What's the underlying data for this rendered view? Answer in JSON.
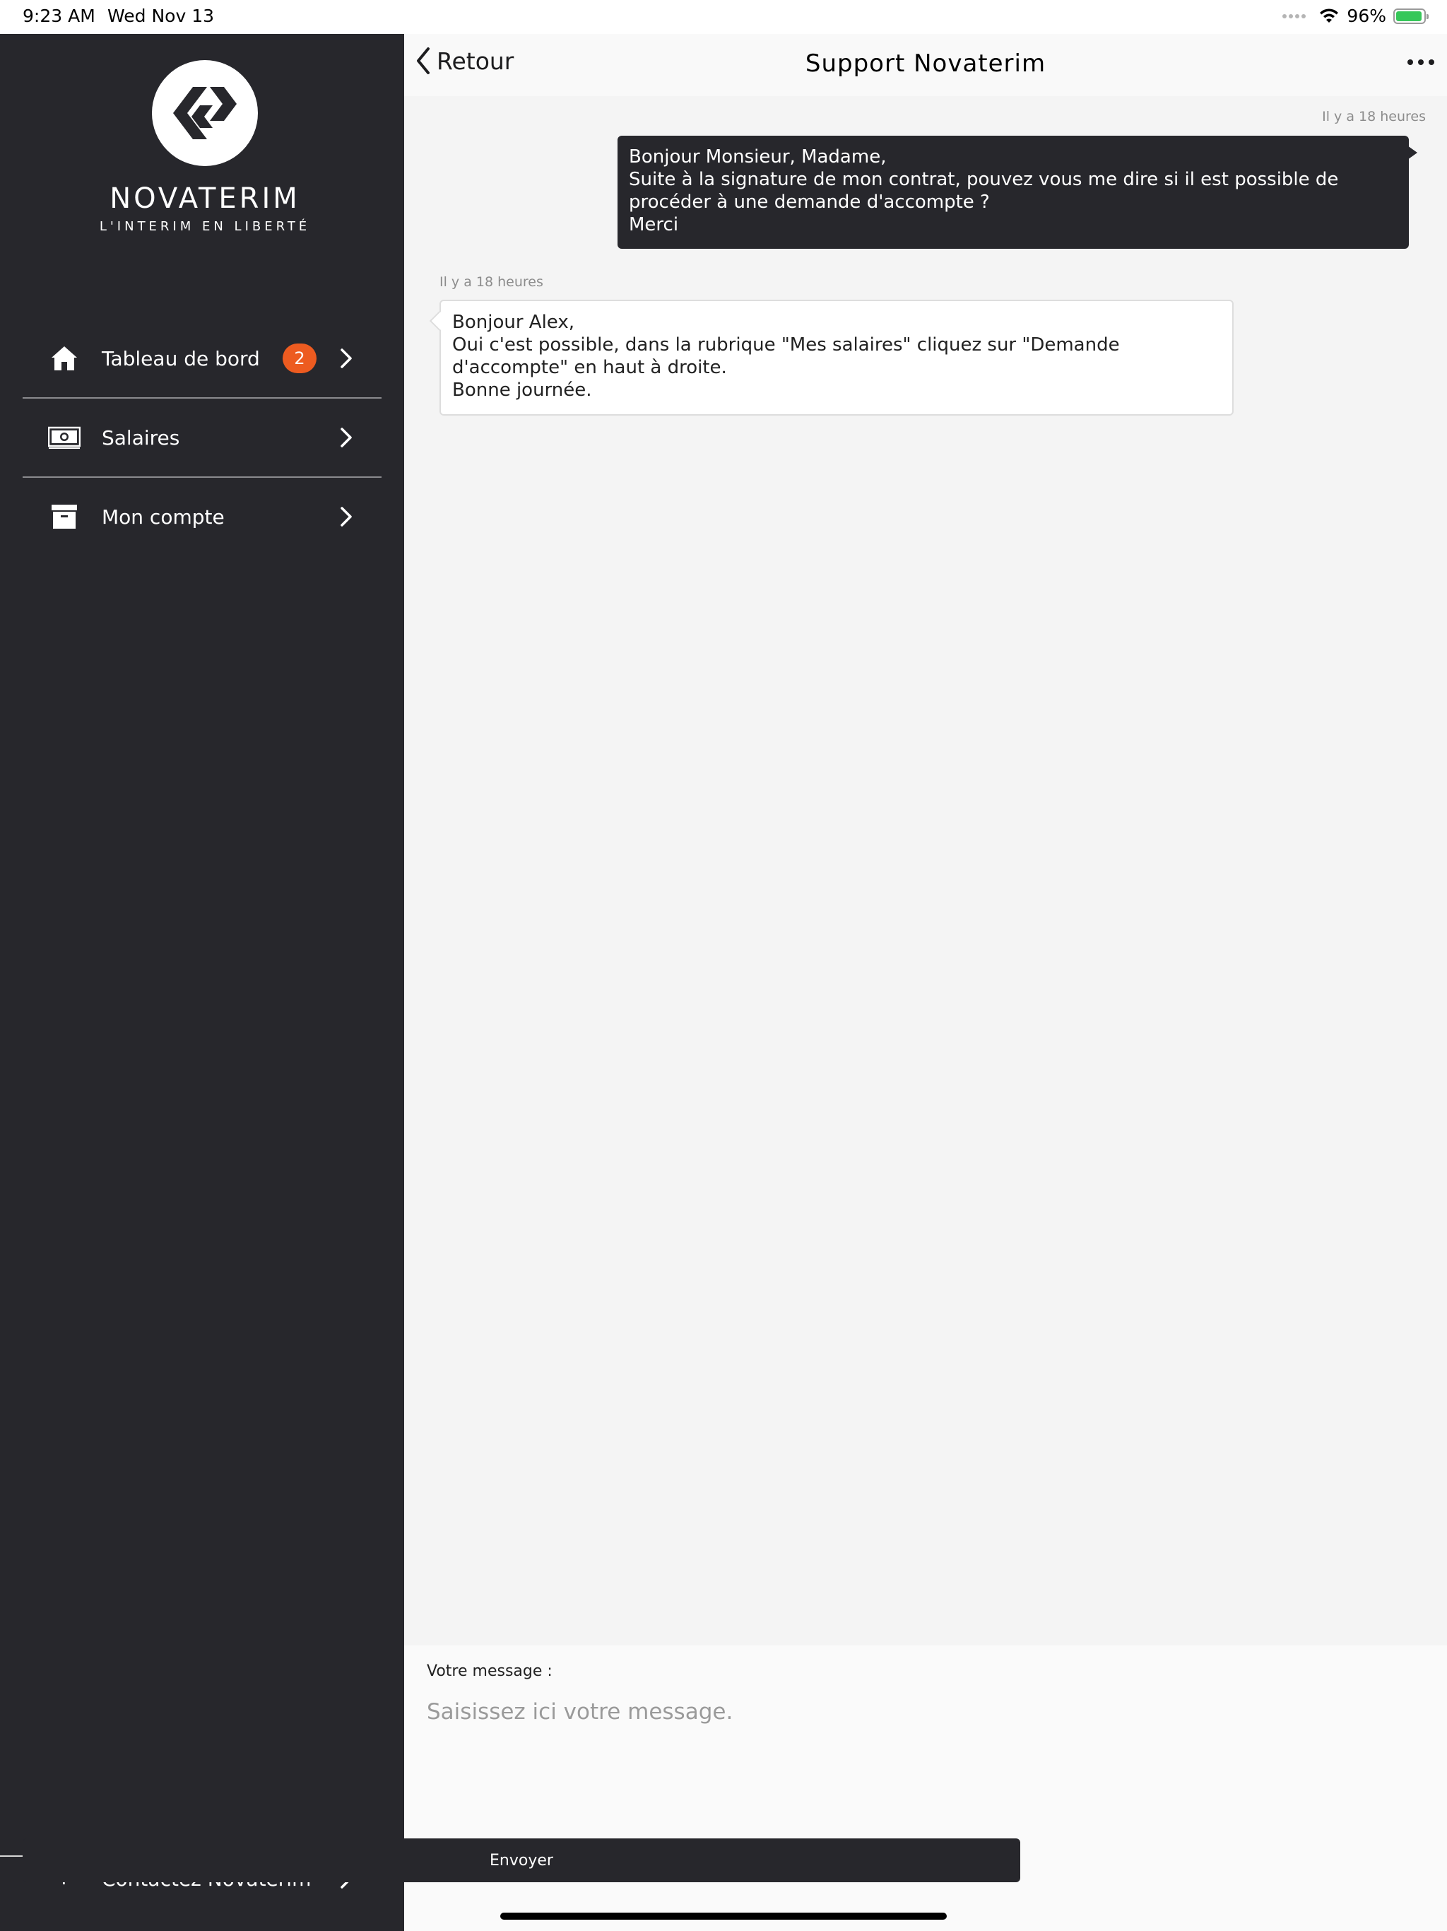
{
  "status_bar": {
    "time": "9:23 AM",
    "date": "Wed Nov 13",
    "battery": "96%",
    "battery_level": 0.96
  },
  "sidebar": {
    "brand": "NOVATERIM",
    "tagline": "L'INTERIM EN LIBERTÉ",
    "items": [
      {
        "label": "Tableau de bord",
        "icon": "home-icon",
        "badge": "2"
      },
      {
        "label": "Salaires",
        "icon": "money-icon"
      },
      {
        "label": "Mon compte",
        "icon": "archive-box-icon"
      }
    ],
    "contact": {
      "label": "Contactez Novaterim",
      "icon_glyph": "?"
    }
  },
  "header": {
    "back_label": "Retour",
    "title": "Support Novaterim"
  },
  "messages": [
    {
      "direction": "outgoing",
      "time": "Il y a 18 heures",
      "text": "Bonjour Monsieur, Madame,\nSuite à la signature de mon contrat, pouvez vous me dire si il est possible de procéder à une demande d'accompte ?\nMerci"
    },
    {
      "direction": "incoming",
      "time": "Il y a 18 heures",
      "text": "Bonjour Alex,\nOui c'est possible, dans la rubrique \"Mes salaires\" cliquez sur \"Demande d'accompte\" en haut à droite.\nBonne journée."
    }
  ],
  "composer": {
    "label": "Votre message :",
    "placeholder": "Saisissez ici votre message.",
    "value": "",
    "send_label": "Envoyer"
  },
  "colors": {
    "sidebar_bg": "#27272c",
    "badge": "#ed5b20",
    "main_bg": "#f4f4f4",
    "battery": "#36c759"
  }
}
